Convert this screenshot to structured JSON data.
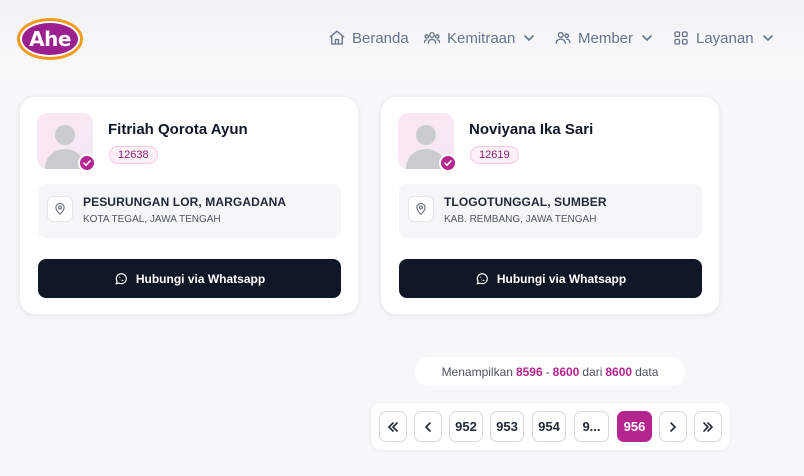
{
  "brand": {
    "logo_text": "Ahe",
    "accent": "#b5258f",
    "logo_ring": "#f39a1e"
  },
  "nav": {
    "items": [
      {
        "label": "Beranda",
        "icon": "home-icon",
        "has_dropdown": false
      },
      {
        "label": "Kemitraan",
        "icon": "users-icon",
        "has_dropdown": true
      },
      {
        "label": "Member",
        "icon": "user-group-icon",
        "has_dropdown": true
      },
      {
        "label": "Layanan",
        "icon": "grid-icon",
        "has_dropdown": true
      }
    ]
  },
  "cards": [
    {
      "name": "Fitriah Qorota Ayun",
      "id": "12638",
      "address_line1": "PESURUNGAN LOR, MARGADANA",
      "address_line2": "KOTA TEGAL, JAWA TENGAH",
      "button_label": "Hubungi via Whatsapp"
    },
    {
      "name": "Noviyana Ika Sari",
      "id": "12619",
      "address_line1": "TLOGOTUNGGAL, SUMBER",
      "address_line2": "KAB. REMBANG, JAWA TENGAH",
      "button_label": "Hubungi via Whatsapp"
    }
  ],
  "summary": {
    "prefix": "Menampilkan",
    "range_start": "8596",
    "separator": "-",
    "range_end": "8600",
    "middle": "dari",
    "total": "8600",
    "suffix": "data"
  },
  "pagination": {
    "first": "«",
    "prev": "‹",
    "pages": [
      "952",
      "953",
      "954",
      "9...",
      "956"
    ],
    "active": "956",
    "next": "›",
    "last": "»"
  }
}
